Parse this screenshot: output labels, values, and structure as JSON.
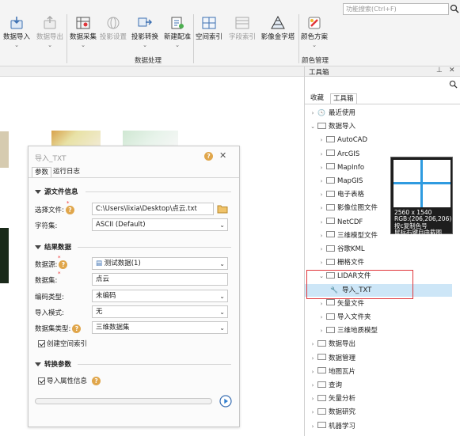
{
  "ribbon": {
    "buttons": [
      {
        "label": "数据导入",
        "icon": "import-icon",
        "enabled": true
      },
      {
        "label": "数据导出",
        "icon": "export-icon",
        "enabled": false
      },
      {
        "label": "数据采集",
        "icon": "data-collect-icon",
        "enabled": true
      },
      {
        "label": "投影设置",
        "icon": "projection-settings-icon",
        "enabled": false
      },
      {
        "label": "投影转换",
        "icon": "projection-transform-icon",
        "enabled": true
      },
      {
        "label": "新建配准",
        "icon": "new-registration-icon",
        "enabled": true
      },
      {
        "label": "空间索引",
        "icon": "spatial-index-icon",
        "enabled": true
      },
      {
        "label": "字段索引",
        "icon": "field-index-icon",
        "enabled": false
      },
      {
        "label": "影像金字塔",
        "icon": "image-pyramid-icon",
        "enabled": true
      },
      {
        "label": "颜色方案",
        "icon": "color-scheme-icon",
        "enabled": true
      }
    ],
    "group_processing": "数据处理",
    "group_color": "颜色管理",
    "search_placeholder": "功能搜索(Ctrl+F)"
  },
  "dialog": {
    "title": "导入_TXT",
    "tabs": [
      "参数",
      "运行日志"
    ],
    "sec_source": "源文件信息",
    "lbl_file": "选择文件:",
    "file_value": "C:\\Users\\lixia\\Desktop\\点云.txt",
    "lbl_charset": "字符集:",
    "charset_value": "ASCII (Default)",
    "sec_result": "结果数据",
    "lbl_datasource": "数据源:",
    "datasource_value": "测试数据(1)",
    "lbl_dataset": "数据集:",
    "dataset_value": "点云",
    "lbl_encoding": "编码类型:",
    "encoding_value": "未编码",
    "lbl_mode": "导入模式:",
    "mode_value": "无",
    "lbl_settype": "数据集类型:",
    "settype_value": "三维数据集",
    "chk_index": "创建空间索引",
    "sec_convert": "转换参数",
    "chk_attr": "导入属性信息",
    "help": "?",
    "close": "✕"
  },
  "toolbox": {
    "title": "工具箱",
    "tabs": [
      "收藏",
      "工具箱"
    ],
    "items": [
      {
        "label": "最近使用",
        "level": 0,
        "exp": "›",
        "kind": "clock"
      },
      {
        "label": "数据导入",
        "level": 0,
        "exp": "⌄",
        "kind": "folder"
      },
      {
        "label": "AutoCAD",
        "level": 1,
        "exp": "›",
        "kind": "folder"
      },
      {
        "label": "ArcGIS",
        "level": 1,
        "exp": "›",
        "kind": "folder"
      },
      {
        "label": "MapInfo",
        "level": 1,
        "exp": "›",
        "kind": "folder"
      },
      {
        "label": "MapGIS",
        "level": 1,
        "exp": "›",
        "kind": "folder"
      },
      {
        "label": "电子表格",
        "level": 1,
        "exp": "›",
        "kind": "folder"
      },
      {
        "label": "影像位图文件",
        "level": 1,
        "exp": "›",
        "kind": "folder"
      },
      {
        "label": "NetCDF",
        "level": 1,
        "exp": "›",
        "kind": "folder"
      },
      {
        "label": "三维模型文件",
        "level": 1,
        "exp": "›",
        "kind": "folder"
      },
      {
        "label": "谷歌KML",
        "level": 1,
        "exp": "›",
        "kind": "folder"
      },
      {
        "label": "栅格文件",
        "level": 1,
        "exp": "›",
        "kind": "folder"
      },
      {
        "label": "LIDAR文件",
        "level": 1,
        "exp": "⌄",
        "kind": "folder"
      },
      {
        "label": "导入_TXT",
        "level": 2,
        "exp": "",
        "kind": "tool"
      },
      {
        "label": "矢量文件",
        "level": 1,
        "exp": "›",
        "kind": "folder"
      },
      {
        "label": "导入文件夹",
        "level": 1,
        "exp": "›",
        "kind": "folder"
      },
      {
        "label": "三维地质模型",
        "level": 1,
        "exp": "›",
        "kind": "folder"
      },
      {
        "label": "数据导出",
        "level": 0,
        "exp": "›",
        "kind": "folder"
      },
      {
        "label": "数据管理",
        "level": 0,
        "exp": "›",
        "kind": "folder"
      },
      {
        "label": "地图瓦片",
        "level": 0,
        "exp": "›",
        "kind": "folder"
      },
      {
        "label": "查询",
        "level": 0,
        "exp": "›",
        "kind": "folder"
      },
      {
        "label": "矢量分析",
        "level": 0,
        "exp": "›",
        "kind": "folder"
      },
      {
        "label": "数据研究",
        "level": 0,
        "exp": "›",
        "kind": "folder"
      },
      {
        "label": "机器学习",
        "level": 0,
        "exp": "›",
        "kind": "folder"
      }
    ]
  },
  "tooltip": {
    "size": "2560 x 1540",
    "rgb": "RGB:(206,206,206)",
    "hint1": "按c复制色号",
    "hint2": "鼠标右键自由截图"
  },
  "colors": {
    "accent": "#2f7fd1",
    "selection": "#cde6f7",
    "highlight_box": "#e0353a",
    "help": "#e0a64b"
  }
}
